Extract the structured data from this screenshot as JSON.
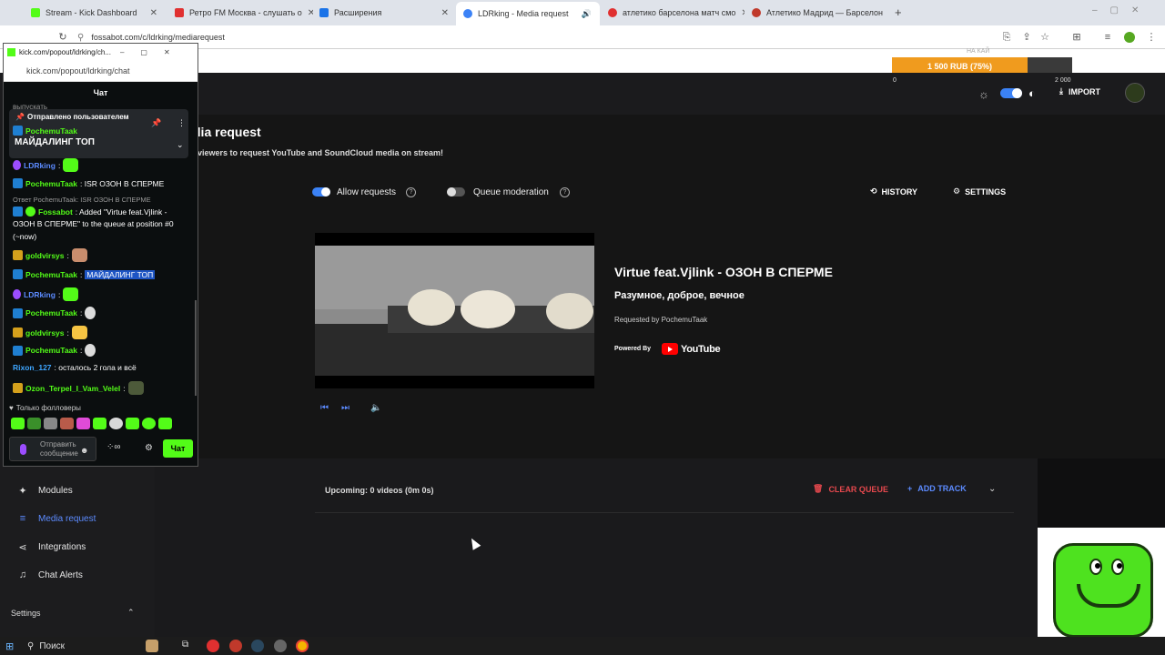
{
  "browser": {
    "tabs": [
      {
        "label": "Stream - Kick Dashboard",
        "color": "#53fc18"
      },
      {
        "label": "Ретро FM Москва - слушать о",
        "color": "#e03030"
      },
      {
        "label": "Расширения",
        "color": "#1a73e8"
      },
      {
        "label": "LDRking - Media request",
        "color": "#3b82f6"
      },
      {
        "label": "атлетико барселона матч смо",
        "color": "#e03030"
      },
      {
        "label": "Атлетико Мадрид — Барселон",
        "color": "#c0392b"
      }
    ],
    "address": "fossabot.com/c/ldrking/mediarequest"
  },
  "goal": {
    "label": "1 500 RUB (75%)",
    "percent": 75,
    "min": "0",
    "max": "2 000",
    "caption": "НА КАЙ"
  },
  "appnav": {
    "import_label": "IMPORT"
  },
  "page": {
    "title": "dia request",
    "subtitle": "viewers to request YouTube and SoundCloud media on stream!",
    "allow_requests_label": "Allow requests",
    "queue_moderation_label": "Queue moderation",
    "history_label": "HISTORY",
    "settings_label": "SETTINGS"
  },
  "now_playing": {
    "title": "Virtue feat.Vjlink - ОЗОН В СПЕРМЕ",
    "channel": "Разумное, доброе, вечное",
    "requested_by": "Requested by PochemuTaak",
    "powered_by": "Powered By",
    "provider": "YouTube"
  },
  "queue": {
    "upcoming": "Upcoming: 0 videos (0m 0s)",
    "clear_label": "CLEAR QUEUE",
    "add_label": "ADD TRACK"
  },
  "sidebar": {
    "items": [
      {
        "label": "Modules",
        "icon": "modules-icon"
      },
      {
        "label": "Media request",
        "icon": "playlist-icon"
      },
      {
        "label": "Integrations",
        "icon": "share-icon"
      },
      {
        "label": "Chat Alerts",
        "icon": "bell-icon"
      }
    ],
    "settings_label": "Settings"
  },
  "popup": {
    "title": "kick.com/popout/ldrking/ch...",
    "address": "kick.com/popout/ldrking/chat",
    "chat_header": "Чат",
    "cut_text": "выпускать",
    "pinned_header": "Отправлено пользователем",
    "pinned_user": "PochemuTaak",
    "pinned_text": "МАЙДАЛИНГ ТОП",
    "messages": [
      {
        "user": "LDRking",
        "text": ":"
      },
      {
        "user": "PochemuTaak",
        "text": ": ISR ОЗОН В СПЕРМЕ"
      },
      {
        "reply": "Ответ PochemuTaak: ISR ОЗОН В СПЕРМЕ"
      },
      {
        "user": "Fossabot",
        "text": ": Added \"Virtue feat.Vjlink -"
      },
      {
        "text": "ОЗОН В СПЕРМЕ\" to the queue at position #0"
      },
      {
        "text": "(~now)"
      },
      {
        "user": "goldvirsys",
        "text": ":"
      },
      {
        "user": "PochemuTaak",
        "text": ":",
        "highlight": "МАЙДАЛИНГ ТОП"
      },
      {
        "user": "LDRking",
        "text": ":"
      },
      {
        "user": "PochemuTaak",
        "text": ":"
      },
      {
        "user": "goldvirsys",
        "text": ":"
      },
      {
        "user": "PochemuTaak",
        "text": ":"
      },
      {
        "user": "Rixon_127",
        "text": ": осталось 2 гола и всё"
      },
      {
        "user": "Ozon_Terpel_I_Vam_Velel",
        "text": ":"
      }
    ],
    "followers_only": "Только фолловеры",
    "input_placeholder": "Отправить сообщение",
    "send_label": "Чат"
  },
  "taskbar": {
    "search_label": "Поиск"
  }
}
